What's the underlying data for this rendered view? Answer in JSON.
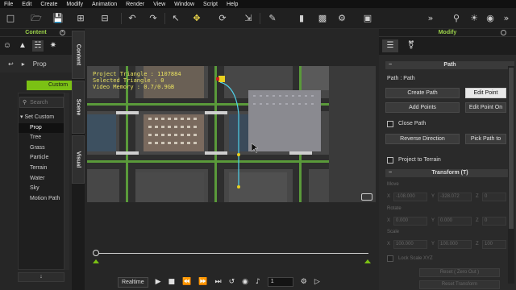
{
  "menu": [
    "File",
    "Edit",
    "Create",
    "Modify",
    "Animation",
    "Render",
    "View",
    "Window",
    "Script",
    "Help"
  ],
  "content_panel": {
    "title": "Content",
    "nav_prefix": "Prop",
    "active_tab_label": "Custom",
    "search_placeholder": "Search",
    "tree_header": "Set Custom",
    "tree_items": [
      "Prop",
      "Tree",
      "Grass",
      "Particle",
      "Terrain",
      "Water",
      "Sky",
      "Motion Path"
    ],
    "selected_item": "Prop",
    "scroll_down_label": "↓"
  },
  "side_tabs": [
    "Content",
    "Scene",
    "Visual"
  ],
  "viewport": {
    "stats": [
      "Project Triangle : 1107884",
      "Selected Triangle : 0",
      "Video Memory : 0.7/0.9GB"
    ]
  },
  "timeline": {
    "realtime_label": "Realtime",
    "frame_value": "1"
  },
  "modify_panel": {
    "title": "Modify",
    "path_section": "Path",
    "path_label": "Path : Path",
    "buttons": {
      "create_path": "Create Path",
      "edit_point": "Edit Point",
      "add_points": "Add Points",
      "edit_point_on": "Edit Point On",
      "reverse_direction": "Reverse Direction",
      "pick_path": "Pick Path to"
    },
    "close_path": "Close Path",
    "project_to_terrain": "Project to Terrain",
    "transform_section": "Transform (T)",
    "move_label": "Move",
    "rotate_label": "Rotate",
    "scale_label": "Scale",
    "move_x": "-108.000",
    "move_y": "-328.072",
    "move_z": "0",
    "rotate_x": "0.000",
    "rotate_y": "0.000",
    "rotate_z": "0",
    "scale_x": "100.000",
    "scale_y": "100.000",
    "scale_z": "100",
    "lock_scale": "Lock Scale XYZ",
    "reset_label": "Reset ( Zero Out )",
    "reset_transform_label": "Reset Transform"
  }
}
